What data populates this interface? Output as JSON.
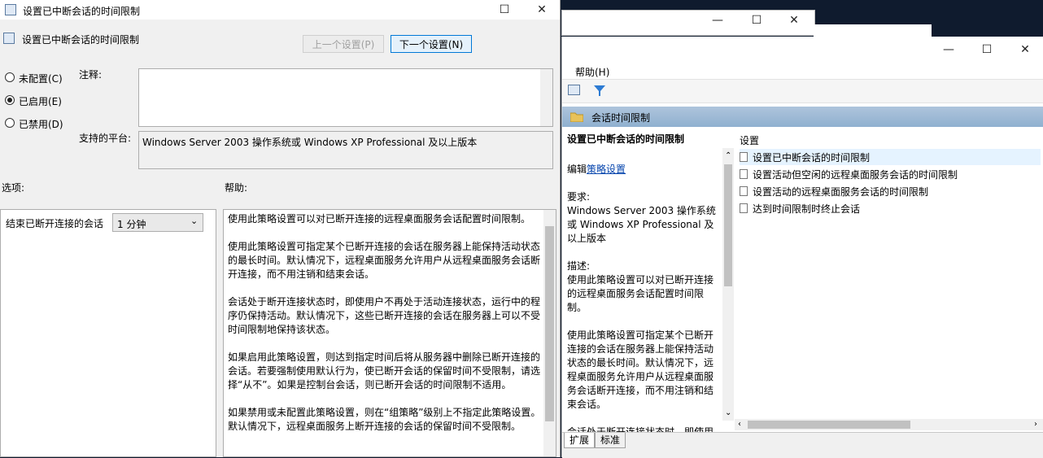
{
  "dialog": {
    "title": "设置已中断会话的时间限制",
    "setting_name": "设置已中断会话的时间限制",
    "prev_button": "上一个设置(P)",
    "next_button": "下一个设置(N)",
    "radio_not_configured": "未配置(C)",
    "radio_enabled": "已启用(E)",
    "radio_disabled": "已禁用(D)",
    "comment_label": "注释:",
    "comment_value": "",
    "platform_label": "支持的平台:",
    "platform_value": "Windows Server 2003 操作系统或 Windows XP Professional 及以上版本",
    "options_label": "选项:",
    "help_label": "帮助:",
    "option_row_label": "结束已断开连接的会话",
    "option_select_value": "1 分钟",
    "help_paragraphs": [
      "使用此策略设置可以对已断开连接的远程桌面服务会话配置时间限制。",
      "使用此策略设置可指定某个已断开连接的会话在服务器上能保持活动状态的最长时间。默认情况下，远程桌面服务允许用户从远程桌面服务会话断开连接，而不用注销和结束会话。",
      "会话处于断开连接状态时，即使用户不再处于活动连接状态，运行中的程序仍保持活动。默认情况下，这些已断开连接的会话在服务器上可以不受时间限制地保持该状态。",
      "如果启用此策略设置，则达到指定时间后将从服务器中删除已断开连接的会话。若要强制使用默认行为，使已断开会话的保留时间不受限制，请选择“从不”。如果是控制台会话，则已断开会话的时间限制不适用。",
      "如果禁用或未配置此策略设置，则在“组策略”级别上不指定此策略设置。默认情况下，远程桌面服务上断开连接的会话的保留时间不受限制。"
    ]
  },
  "editor": {
    "menu_help": "帮助(H)",
    "folder_title": "会话时间限制",
    "left_title": "设置已中断会话的时间限制",
    "edit_prefix": "编辑",
    "edit_link": "策略设置",
    "requirements_label": "要求:",
    "requirements_text": "Windows Server 2003 操作系统或 Windows XP Professional 及以上版本",
    "description_label": "描述:",
    "description_p1": "使用此策略设置可以对已断开连接的远程桌面服务会话配置时间限制。",
    "description_p2": "使用此策略设置可指定某个已断开连接的会话在服务器上能保持活动状态的最长时间。默认情况下，远程桌面服务允许用户从远程桌面服务会话断开连接，而不用注销和结束会话。",
    "description_p3": "会话处于断开连接状态时，即使用户不再处于活动连接状态，运行中的程序仍保持活动。",
    "column_header": "设置",
    "list_items": [
      "设置已中断会话的时间限制",
      "设置活动但空闲的远程桌面服务会话的时间限制",
      "设置活动的远程桌面服务会话的时间限制",
      "达到时间限制时终止会话"
    ],
    "tab_extended": "扩展",
    "tab_standard": "标准"
  },
  "window_controls": {
    "minimize": "—",
    "maximize": "☐",
    "close": "✕"
  },
  "icons": [
    "policy-icon",
    "folder-icon",
    "filter-icon",
    "console-icon",
    "doc-icon"
  ]
}
